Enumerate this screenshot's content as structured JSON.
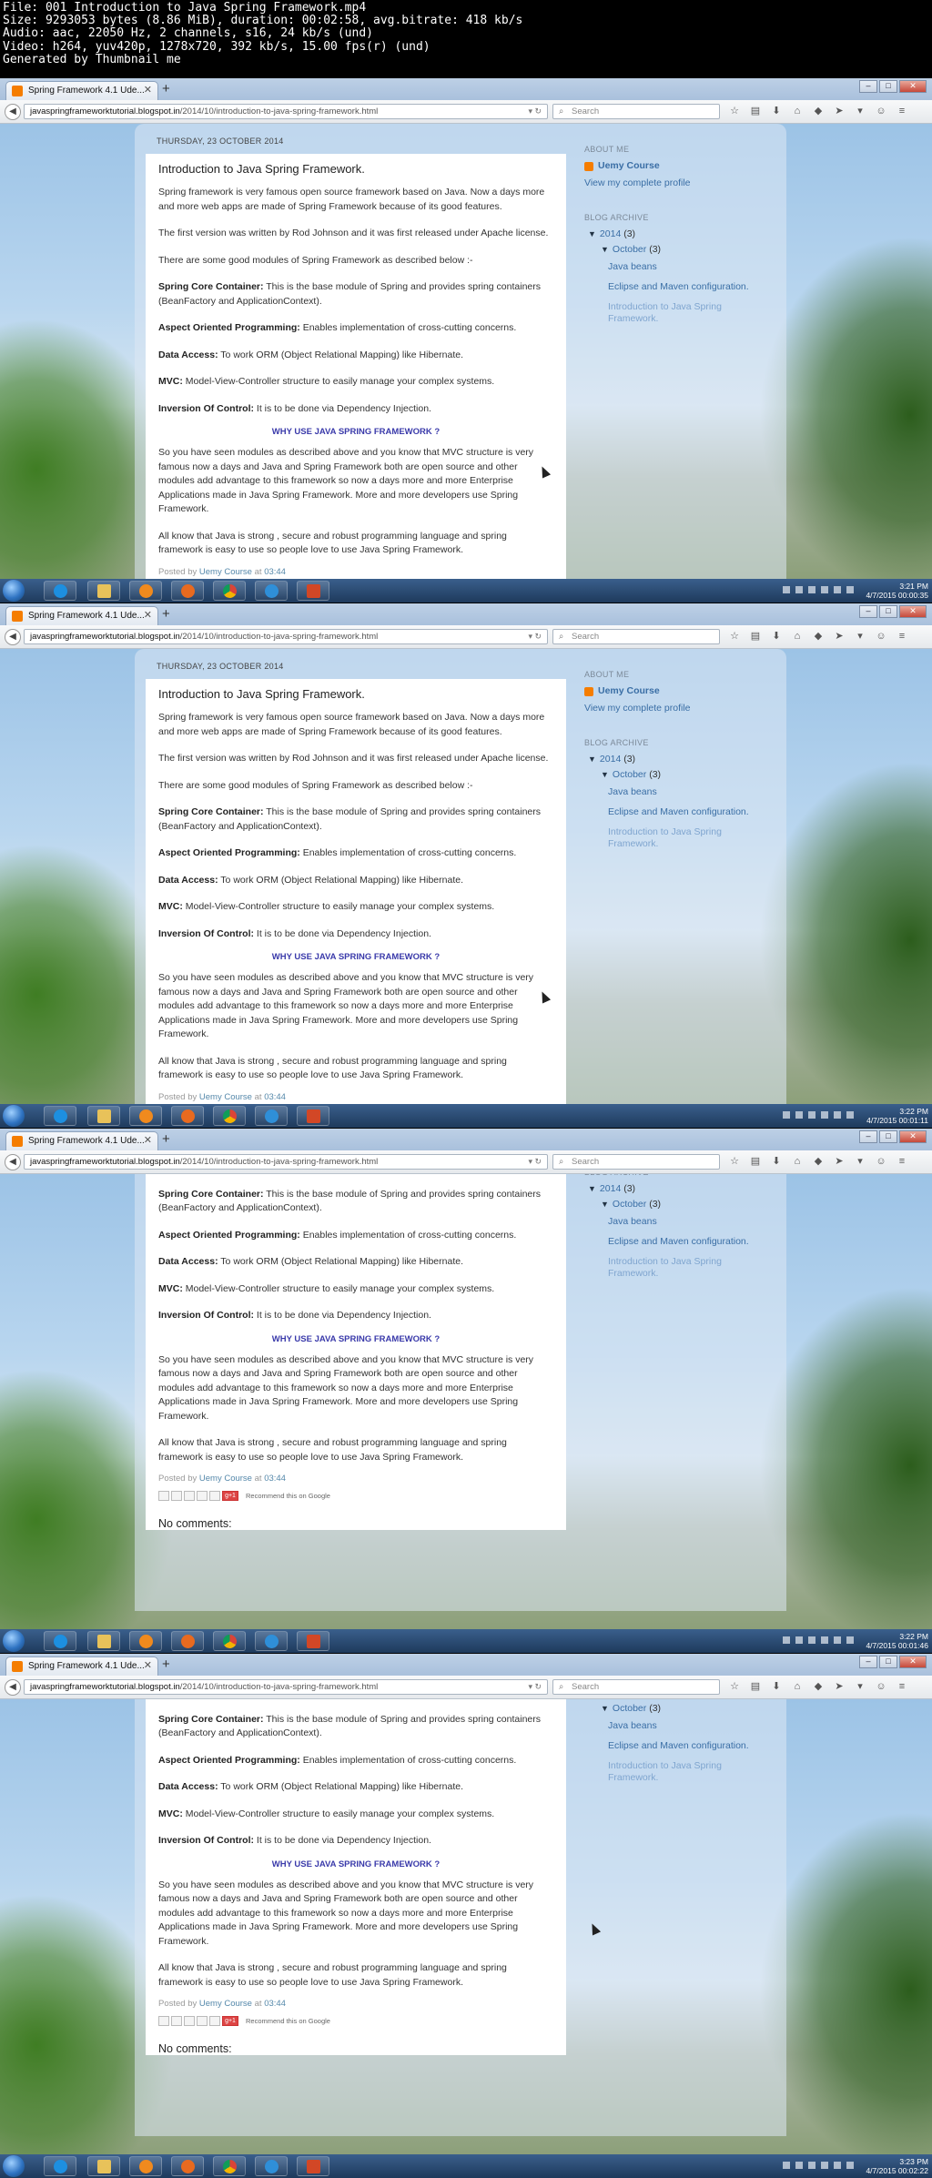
{
  "video_info": {
    "line1": "File: 001 Introduction to Java Spring Framework.mp4",
    "line2": "Size: 9293053 bytes (8.86 MiB), duration: 00:02:58, avg.bitrate: 418 kb/s",
    "line3": "Audio: aac, 22050 Hz, 2 channels, s16, 24 kb/s (und)",
    "line4": "Video: h264, yuv420p, 1278x720, 392 kb/s, 15.00 fps(r) (und)",
    "line5": "Generated by Thumbnail me"
  },
  "browser": {
    "tab_title": "Spring Framework 4.1 Ude...",
    "url_domain": "javaspringframeworktutorial.blogspot.in",
    "url_path": "/2014/10/introduction-to-java-spring-framework.html",
    "search_placeholder": "Search"
  },
  "post": {
    "date": "THURSDAY, 23 OCTOBER 2014",
    "title": "Introduction to Java Spring Framework.",
    "p1": "Spring framework is very famous open source framework based on Java. Now a days more and more web apps are made of Spring Framework because of its good features.",
    "p2": "The first version was written by Rod Johnson and it was first released under Apache license.",
    "p3": "There are some good modules of Spring Framework as described below :-",
    "m1_label": "Spring Core Container:",
    "m1_text": " This is the base module of Spring and provides spring containers (BeanFactory and ApplicationContext).",
    "m2_label": "Aspect Oriented Programming:",
    "m2_text": " Enables implementation of cross-cutting concerns.",
    "m3_label": "Data Access:",
    "m3_text": " To work ORM (Object Relational Mapping) like Hibernate.",
    "m4_label": "MVC:",
    "m4_text": " Model-View-Controller structure to easily manage your complex systems.",
    "m5_label": "Inversion Of Control:",
    "m5_text": " It is to be done via Dependency Injection.",
    "why": "WHY USE JAVA SPRING FRAMEWORK ?",
    "p4": "So you have seen modules as described above and you know that MVC structure is very famous now a days and Java and Spring Framework both are open source and other modules add advantage to this framework so now a days more and more Enterprise Applications made in Java Spring Framework. More and more developers use Spring Framework.",
    "p5": "All know that Java is strong , secure and robust programming language and spring framework is easy to use so people love to use Java Spring Framework.",
    "posted_by": "Posted by",
    "author": "Uemy Course",
    "at": "at",
    "time": "03:44",
    "gplus": "g+1",
    "recommend": "Recommend this on Google",
    "no_comments": "No comments:"
  },
  "sidebar": {
    "about_heading": "ABOUT ME",
    "profile_name": "Uemy Course",
    "view_profile": "View my complete profile",
    "archive_heading": "BLOG ARCHIVE",
    "year": "2014",
    "year_count": "(3)",
    "month": "October",
    "month_count": "(3)",
    "posts": [
      "Java beans",
      "Eclipse and Maven configuration.",
      "Introduction to Java Spring Framework."
    ]
  },
  "frames": [
    {
      "clock_time": "3:21 PM",
      "clock_stamp": "4/7/2015 00:00:35"
    },
    {
      "clock_time": "3:22 PM",
      "clock_stamp": "4/7/2015 00:01:11"
    },
    {
      "clock_time": "3:22 PM",
      "clock_stamp": "4/7/2015 00:01:46"
    },
    {
      "clock_time": "3:23 PM",
      "clock_stamp": "4/7/2015 00:02:22"
    }
  ]
}
